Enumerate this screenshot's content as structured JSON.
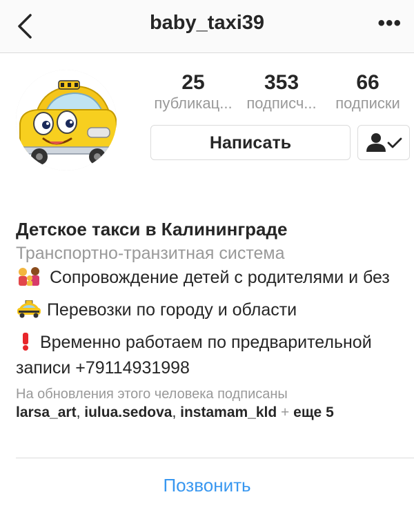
{
  "header": {
    "username": "baby_taxi39",
    "back_icon": "chevron-left-icon",
    "more_icon": "more-horizontal-icon",
    "more_text": "•••"
  },
  "profile": {
    "avatar_icon": "yellow-taxi-cartoon",
    "stats": [
      {
        "value": "25",
        "label": "публикац..."
      },
      {
        "value": "353",
        "label": "подписч..."
      },
      {
        "value": "66",
        "label": "подписки"
      }
    ],
    "message_button": "Написать",
    "follow_icon": "person-check-icon"
  },
  "bio": {
    "name": "Детское такси в Калининграде",
    "category": "Транспортно-транзитная система",
    "line1": "Сопровождение детей с родителями и без",
    "line2": "Перевозки по городу и области",
    "line3": "Временно работаем по предварительной записи +79114931998",
    "followed_label": "На обновления этого человека подписаны",
    "followed_users": [
      "larsa_art",
      "iulua.sedova",
      "instamam_kld"
    ],
    "followed_more": "еще 5",
    "followed_plus": "+"
  },
  "actions": {
    "call": "Позвонить"
  },
  "colors": {
    "link": "#3897f0",
    "muted": "#999999",
    "text": "#262626",
    "taxi_yellow": "#f5c51a"
  }
}
